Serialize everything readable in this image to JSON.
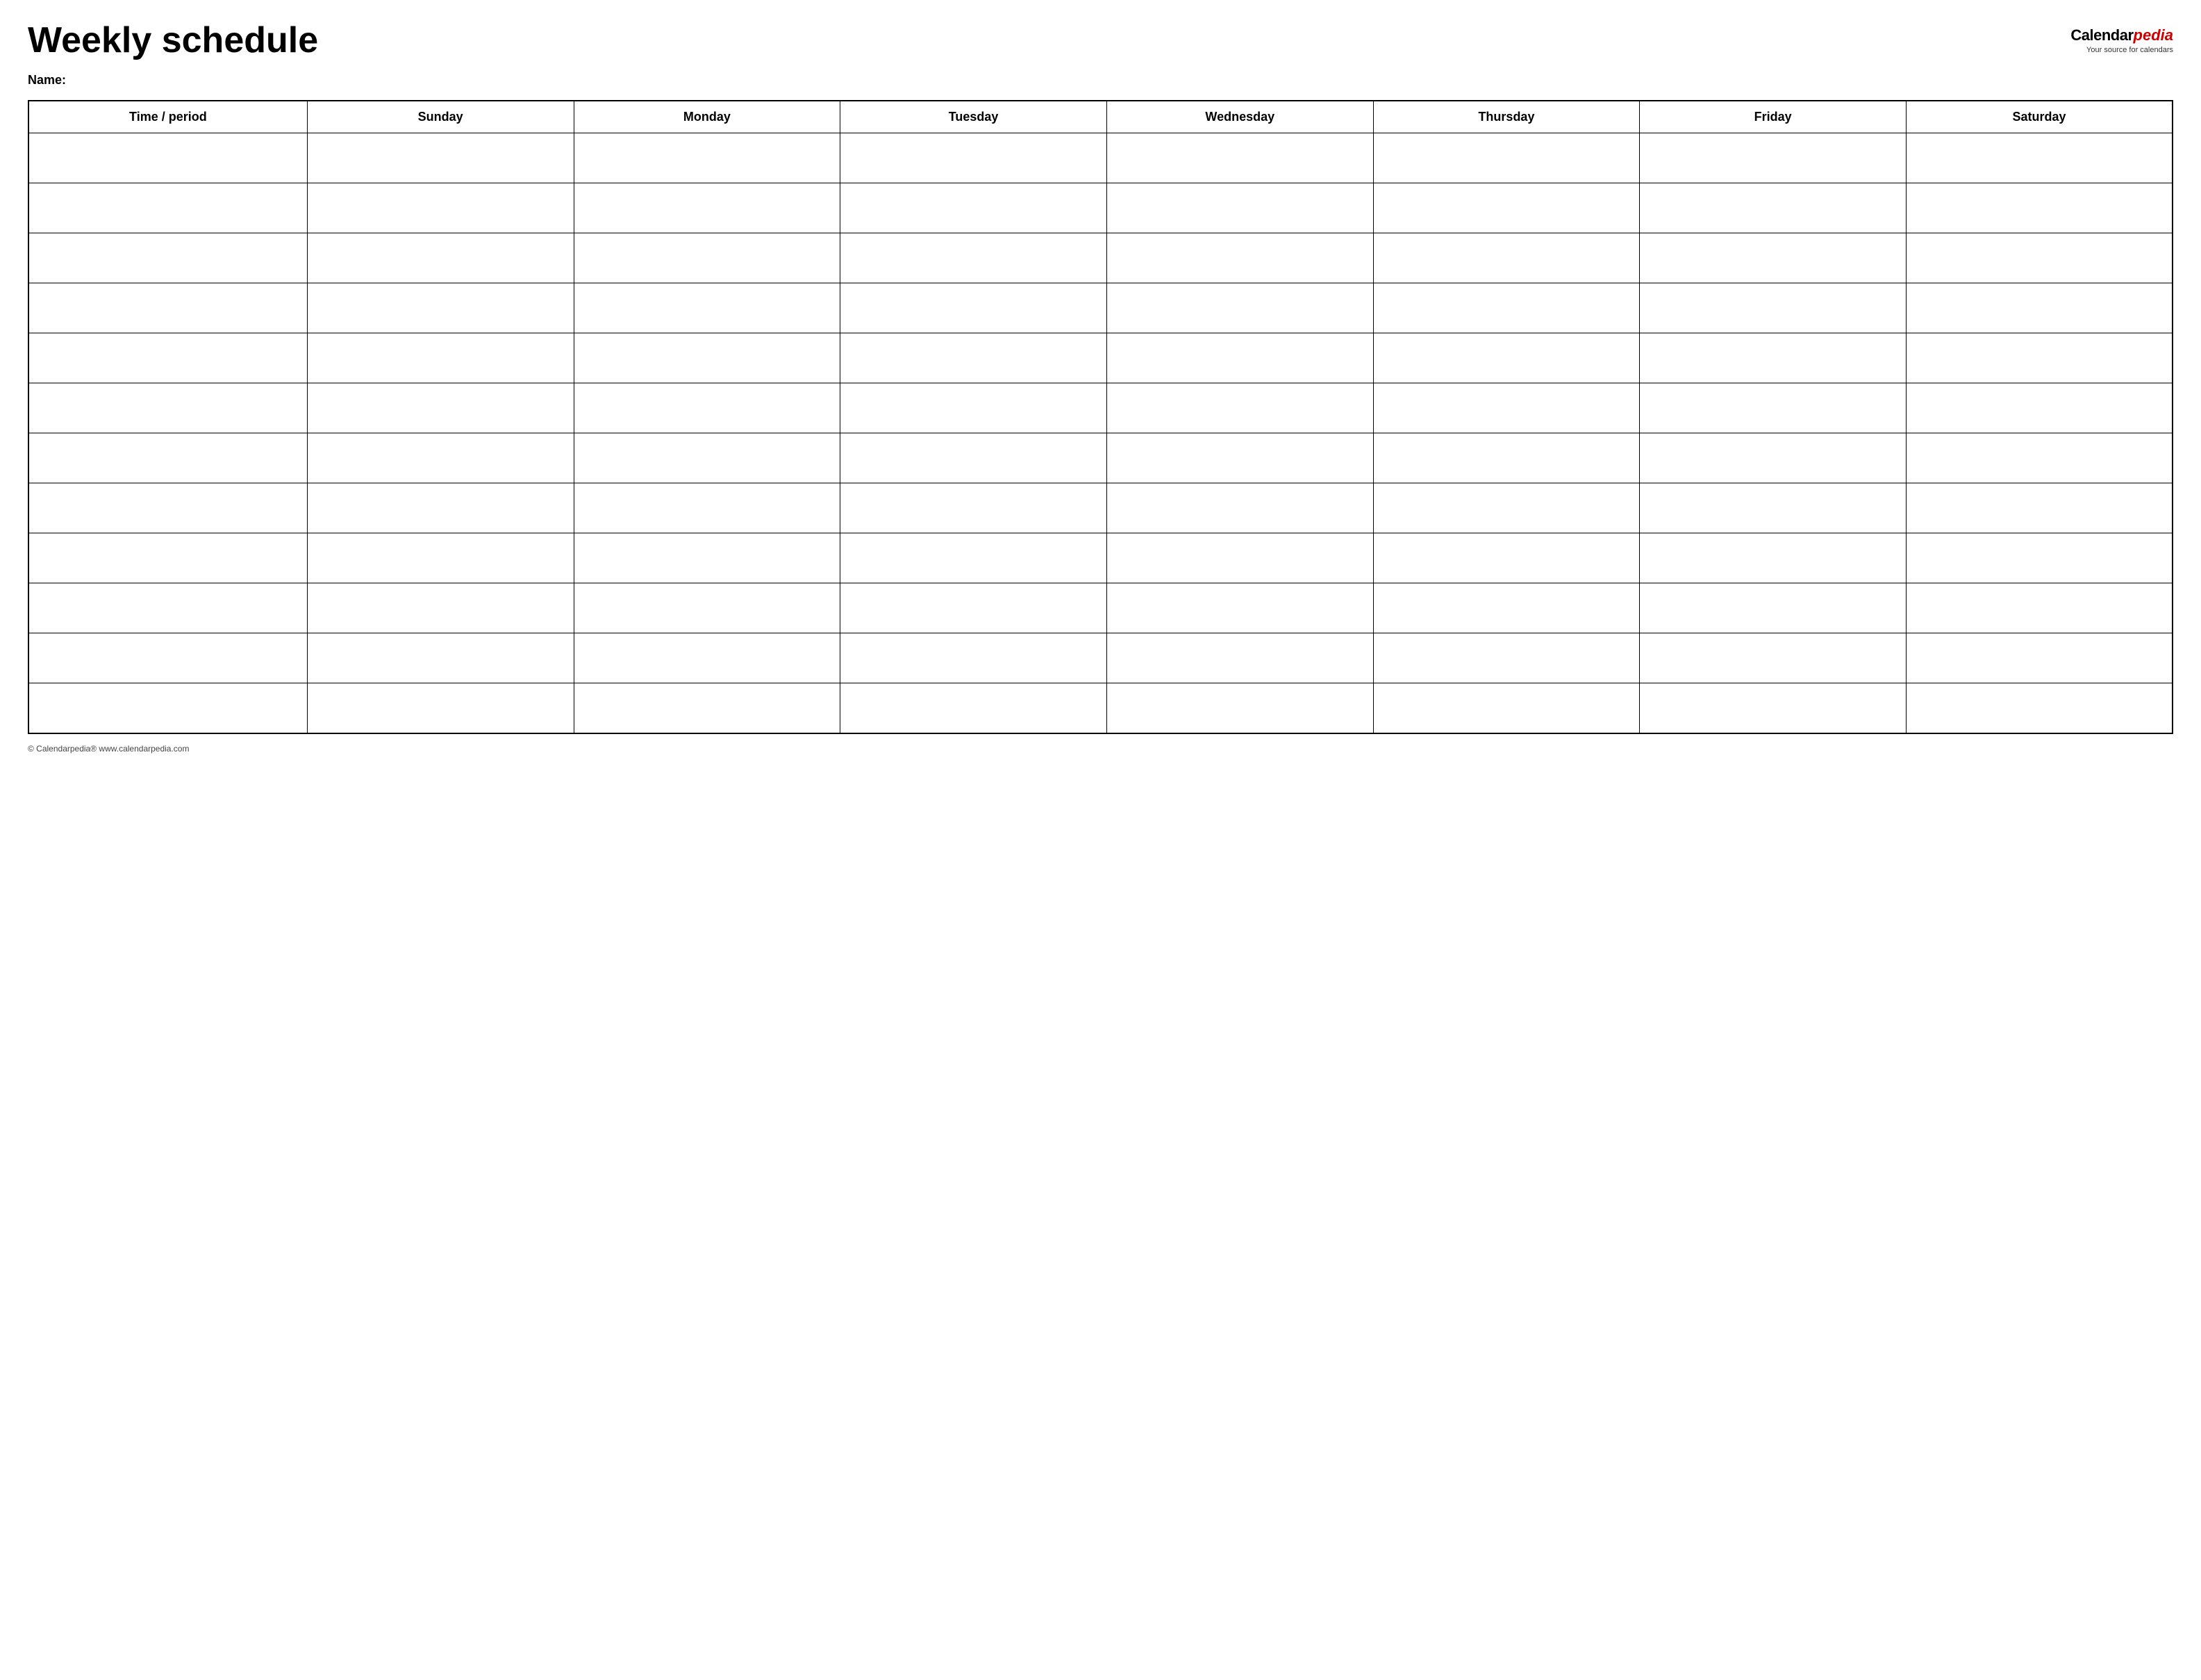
{
  "header": {
    "title": "Weekly schedule",
    "brand": {
      "calendar_part": "Calendar",
      "pedia_part": "pedia",
      "tagline": "Your source for calendars"
    }
  },
  "name_label": "Name:",
  "table": {
    "columns": [
      {
        "id": "time",
        "label": "Time / period"
      },
      {
        "id": "sunday",
        "label": "Sunday"
      },
      {
        "id": "monday",
        "label": "Monday"
      },
      {
        "id": "tuesday",
        "label": "Tuesday"
      },
      {
        "id": "wednesday",
        "label": "Wednesday"
      },
      {
        "id": "thursday",
        "label": "Thursday"
      },
      {
        "id": "friday",
        "label": "Friday"
      },
      {
        "id": "saturday",
        "label": "Saturday"
      }
    ],
    "rows": 12
  },
  "footer": {
    "text": "© Calendarpedia®  www.calendarpedia.com"
  }
}
